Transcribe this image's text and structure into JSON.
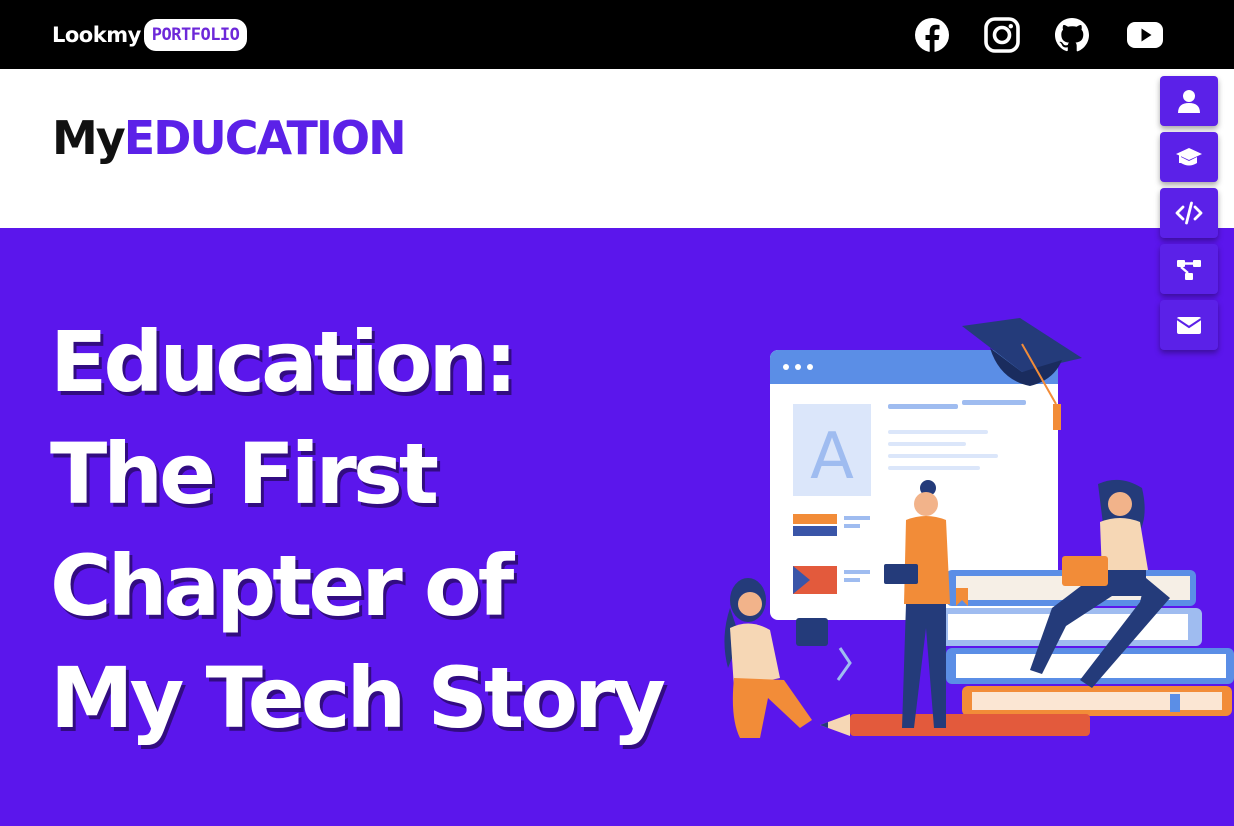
{
  "header": {
    "logo_text": "Lookmy",
    "logo_badge": "PORTFOLIO",
    "socials": [
      {
        "name": "facebook-icon"
      },
      {
        "name": "instagram-icon"
      },
      {
        "name": "github-icon"
      },
      {
        "name": "youtube-icon"
      }
    ]
  },
  "page": {
    "heading_prefix": "My",
    "heading_main": "EDUCATION"
  },
  "sidenav": {
    "items": [
      {
        "icon": "user-icon"
      },
      {
        "icon": "graduation-cap-icon"
      },
      {
        "icon": "code-icon"
      },
      {
        "icon": "project-diagram-icon"
      },
      {
        "icon": "envelope-icon"
      }
    ]
  },
  "hero": {
    "lines": [
      "Education:",
      "The First",
      "Chapter of",
      "My Tech Story"
    ],
    "illustration_letter": "A"
  },
  "colors": {
    "accent": "#5b21e8",
    "hero_bg": "#5b16ec",
    "topbar_bg": "#000000"
  }
}
